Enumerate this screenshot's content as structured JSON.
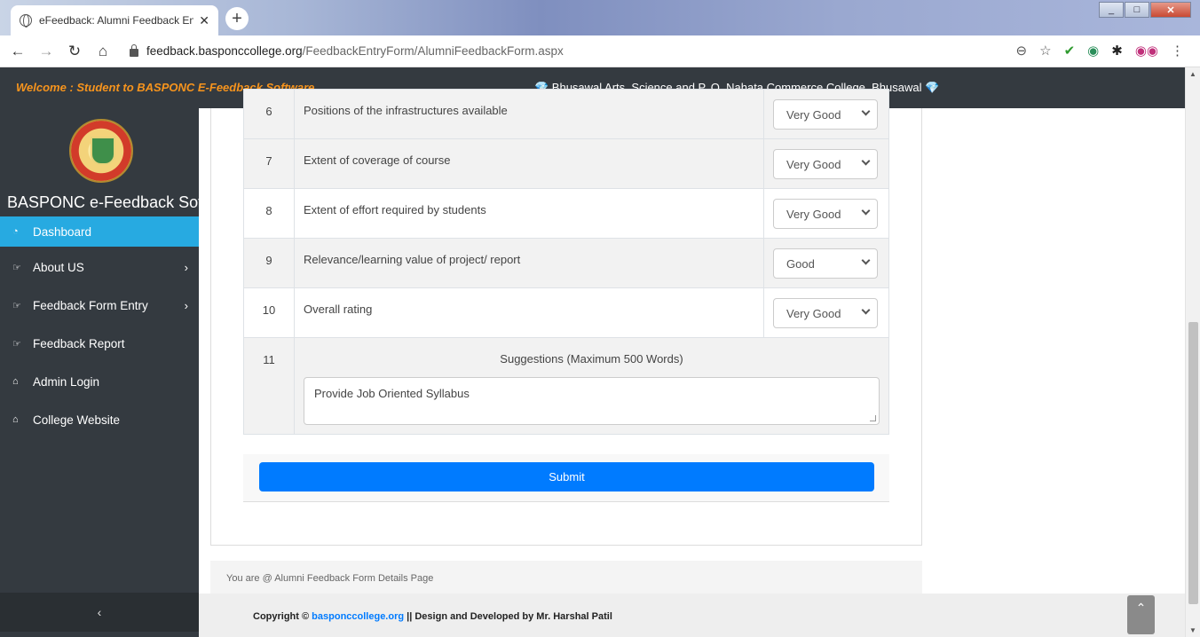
{
  "browser": {
    "tab_title": "eFeedback: Alumni Feedback Ent",
    "url_domain": "feedback.basponccollege.org",
    "url_path": "/FeedbackEntryForm/AlumniFeedbackForm.aspx"
  },
  "header": {
    "welcome": "Welcome : Student to BASPONC E-Feedback Software",
    "college": "💎 Bhusawal Arts, Science and P. O. Nahata Commerce College, Bhusawal 💎"
  },
  "sidebar": {
    "app_name": "BASPONC e-Feedback Software",
    "items": [
      {
        "label": "Dashboard"
      },
      {
        "label": "About US"
      },
      {
        "label": "Feedback Form Entry"
      },
      {
        "label": "Feedback Report"
      },
      {
        "label": "Admin Login"
      },
      {
        "label": "College Website"
      }
    ],
    "collapse": "‹"
  },
  "form": {
    "partial_row": {
      "no": "6",
      "question": "Positions of the infrastructures available",
      "answer": "Very Good"
    },
    "rows": [
      {
        "no": "7",
        "question": "Extent of coverage of course",
        "answer": "Very Good"
      },
      {
        "no": "8",
        "question": "Extent of effort required by students",
        "answer": "Very Good"
      },
      {
        "no": "9",
        "question": "Relevance/learning value of project/ report",
        "answer": "Good"
      },
      {
        "no": "10",
        "question": "Overall rating",
        "answer": "Very Good"
      }
    ],
    "suggestion": {
      "no": "11",
      "heading": "Suggestions (Maximum 500 Words)",
      "value": "Provide Job Oriented Syllabus"
    },
    "submit_label": "Submit"
  },
  "breadcrumb": "You are @ Alumni Feedback Form Details Page",
  "footer": {
    "prefix": "Copyright ©",
    "link": "basponccollege.org",
    "suffix": "|| Design and Developed by Mr. Harshal Patil"
  },
  "colors": {
    "accent": "#27aae1",
    "submit": "#007bff",
    "welcome": "#f7941d",
    "dark": "#343a40"
  }
}
